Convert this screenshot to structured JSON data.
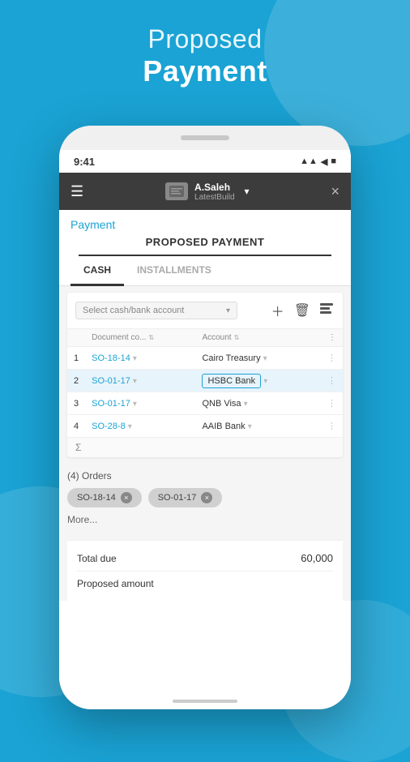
{
  "background": {
    "color": "#1aa3d4"
  },
  "page_title": {
    "line1": "Proposed",
    "line2": "Payment"
  },
  "phone": {
    "status_bar": {
      "time": "9:41",
      "icons": "▲▲ ◀ ■"
    },
    "nav": {
      "user_name": "A.Saleh",
      "user_sub": "LatestBuild",
      "close_icon": "×"
    },
    "payment_label": "Payment",
    "proposed_payment_title": "PROPOSED PAYMENT",
    "tabs": [
      {
        "label": "CASH",
        "active": true
      },
      {
        "label": "INSTALLMENTS",
        "active": false
      }
    ],
    "table": {
      "select_placeholder": "Select cash/bank account",
      "columns": [
        {
          "label": "Document co...",
          "sortable": true
        },
        {
          "label": "Account",
          "sortable": true
        },
        {
          "label": "⋮",
          "sortable": false
        }
      ],
      "rows": [
        {
          "num": "1",
          "doc": "SO-18-14",
          "account": "Cairo Treasury",
          "selected": false
        },
        {
          "num": "2",
          "doc": "SO-01-17",
          "account": "HSBC Bank",
          "selected": true
        },
        {
          "num": "3",
          "doc": "SO-01-17",
          "account": "QNB Visa",
          "selected": false
        },
        {
          "num": "4",
          "doc": "SO-28-8",
          "account": "AAIB Bank",
          "selected": false
        }
      ],
      "sigma": "Σ"
    },
    "orders": {
      "label": "(4) Orders",
      "chips": [
        {
          "text": "SO-18-14",
          "removable": true
        },
        {
          "text": "SO-01-17",
          "removable": true
        }
      ],
      "more_label": "More..."
    },
    "totals": {
      "total_due_label": "Total due",
      "total_due_value": "60,000",
      "proposed_label": "Proposed amount"
    }
  }
}
